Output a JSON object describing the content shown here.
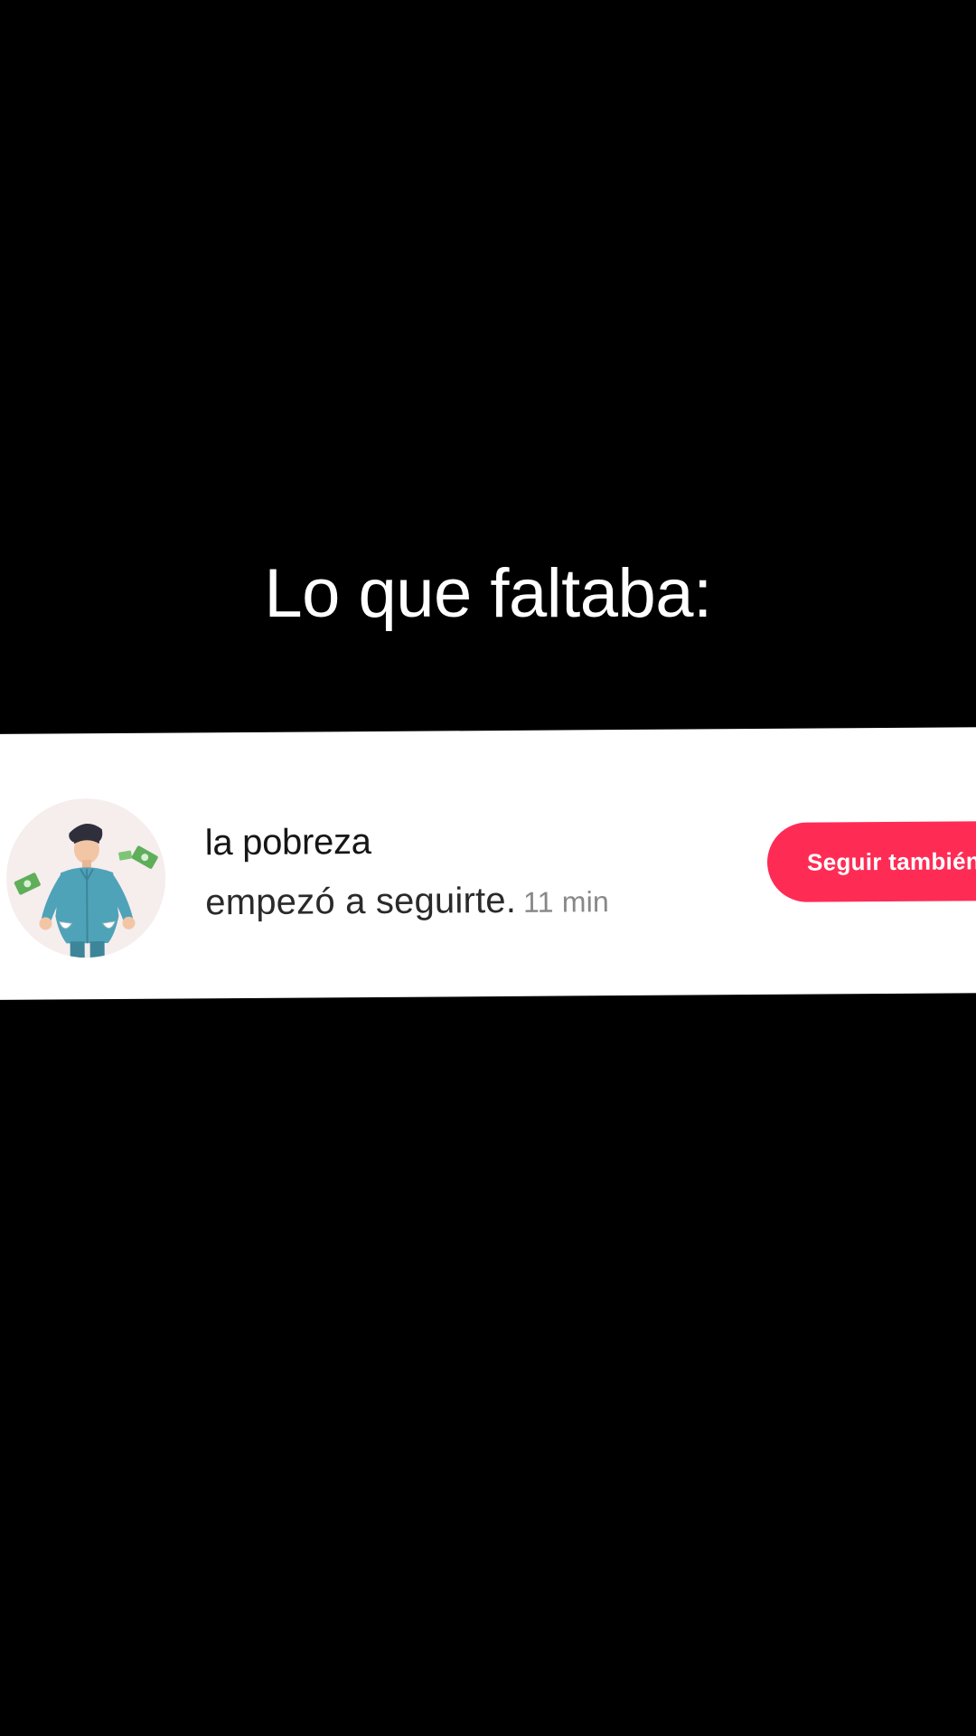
{
  "caption": "Lo que faltaba:",
  "notification": {
    "username": "la pobreza",
    "activity_text": "empezó a seguirte.",
    "timestamp": "11 min",
    "follow_button_label": "Seguir también",
    "avatar_icon": "poor-man-empty-pockets-icon"
  },
  "colors": {
    "background": "#000000",
    "card": "#ffffff",
    "follow_button": "#fe2c55",
    "shirt": "#4fa3b8",
    "money": "#5fae5a"
  }
}
